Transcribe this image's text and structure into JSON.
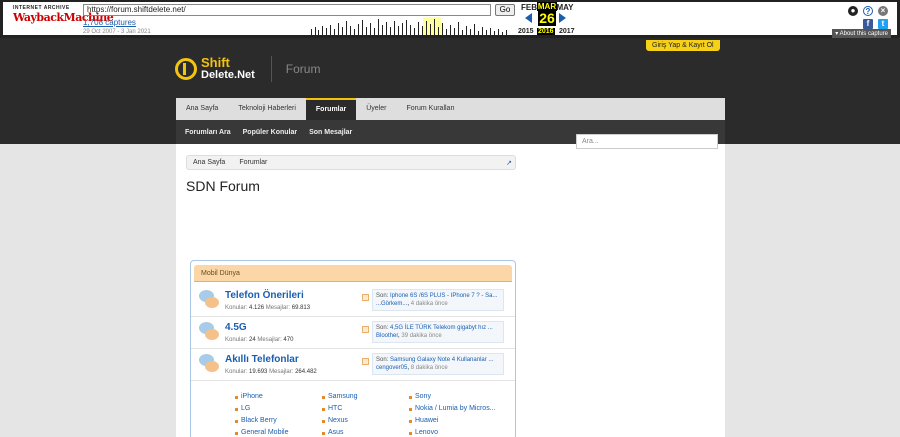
{
  "wayback": {
    "logo_top": "INTERNET ARCHIVE",
    "logo_main": "WaybackMachine",
    "url": "https://forum.shiftdelete.net/",
    "go": "Go",
    "captures": "1,708 captures",
    "range": "29 Oct 2007 - 3 Jan 2021",
    "months": {
      "prev": "FEB",
      "cur": "MAR",
      "next": "MAY"
    },
    "day": "26",
    "years": {
      "prev": "2015",
      "cur": "2016",
      "next": "2017"
    },
    "about": "About this capture",
    "colors": {
      "accent": "#1a5eb0",
      "highlight": "#ffff00"
    }
  },
  "site": {
    "login": "Giriş Yap & Kayıt Ol",
    "logo_line1": "Shift",
    "logo_line2": "Delete.Net",
    "section": "Forum",
    "tabs": [
      "Ana Sayfa",
      "Teknoloji Haberleri",
      "Forumlar",
      "Üyeler",
      "Forum Kuralları"
    ],
    "subnav": [
      "Forumları Ara",
      "Popüler Konular",
      "Son Mesajlar"
    ],
    "search_placeholder": "Ara...",
    "colors": {
      "brand": "#f2c30f",
      "dark": "#2b2b2b"
    }
  },
  "content": {
    "breadcrumb": [
      "Ana Sayfa",
      "Forumlar"
    ],
    "title": "SDN Forum",
    "category": "Mobil Dünya",
    "stats_labels": {
      "threads": "Konular:",
      "messages": "Mesajlar:"
    },
    "nodes": [
      {
        "title": "Telefon Önerileri",
        "threads": "4.126",
        "messages": "69.813",
        "last_label": "Son:",
        "last_title": "Iphone 6S /6S PLUS - IPhone 7 ? - Sa...",
        "last_user": "...Görkem...",
        "last_time": "4 dakika önce"
      },
      {
        "title": "4.5G",
        "threads": "24",
        "messages": "470",
        "last_label": "Son:",
        "last_title": "4,5G İLE TÜRK Telekom gigabyt hız ...",
        "last_user": "Bloother",
        "last_time": "39 dakika önce"
      },
      {
        "title": "Akıllı Telefonlar",
        "threads": "19.693",
        "messages": "264.482",
        "last_label": "Son:",
        "last_title": "Samsung Galaxy Note 4 Kullananlar ...",
        "last_user": "cengover05",
        "last_time": "8 dakika önce"
      }
    ],
    "subforums": [
      "iPhone",
      "Samsung",
      "Sony",
      "LG",
      "HTC",
      "Nokia / Lumia by Micros...",
      "Black Berry",
      "Nexus",
      "Huawei",
      "General Mobile",
      "Asus",
      "Lenovo"
    ]
  }
}
